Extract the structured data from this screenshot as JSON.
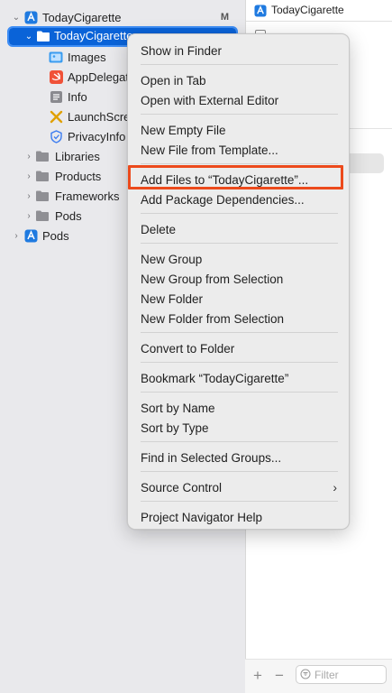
{
  "navigator": {
    "rows": [
      {
        "label": "TodayCigarette",
        "badge": "M"
      },
      {
        "label": "TodayCigarette"
      },
      {
        "label": "Images"
      },
      {
        "label": "AppDelegate"
      },
      {
        "label": "Info"
      },
      {
        "label": "LaunchScre"
      },
      {
        "label": "PrivacyInfo"
      },
      {
        "label": "Libraries"
      },
      {
        "label": "Products"
      },
      {
        "label": "Frameworks"
      },
      {
        "label": "Pods"
      },
      {
        "label": "Pods"
      }
    ]
  },
  "right_panel": {
    "title": "TodayCigarette",
    "filter_placeholder": "Filter",
    "add_label": "+",
    "remove_label": "−"
  },
  "context_menu": {
    "items": [
      {
        "label": "Show in Finder"
      },
      {
        "label": "Open in Tab"
      },
      {
        "label": "Open with External Editor"
      },
      {
        "label": "New Empty File"
      },
      {
        "label": "New File from Template..."
      },
      {
        "label": "Add Files to “TodayCigarette”..."
      },
      {
        "label": "Add Package Dependencies..."
      },
      {
        "label": "Delete"
      },
      {
        "label": "New Group"
      },
      {
        "label": "New Group from Selection"
      },
      {
        "label": "New Folder"
      },
      {
        "label": "New Folder from Selection"
      },
      {
        "label": "Convert to Folder"
      },
      {
        "label": "Bookmark “TodayCigarette”"
      },
      {
        "label": "Sort by Name"
      },
      {
        "label": "Sort by Type"
      },
      {
        "label": "Find in Selected Groups..."
      },
      {
        "label": "Source Control",
        "submenu_arrow": "›"
      },
      {
        "label": "Project Navigator Help"
      }
    ]
  },
  "colors": {
    "selection": "#0a63d8",
    "highlight_box": "#ec4a1c",
    "menu_bg": "#ececec",
    "folder": "#8f8f94",
    "project_icon": "#1f7ae0",
    "swift_icon": "#f05138",
    "launch_icon": "#e0a000"
  },
  "icons": {
    "project": "xcode-project-icon",
    "folder": "folder-icon",
    "asset_catalog": "asset-catalog-icon",
    "swift_file": "swift-file-icon",
    "plist": "plist-icon",
    "storyboard": "storyboard-icon",
    "privacy": "privacy-manifest-icon"
  }
}
